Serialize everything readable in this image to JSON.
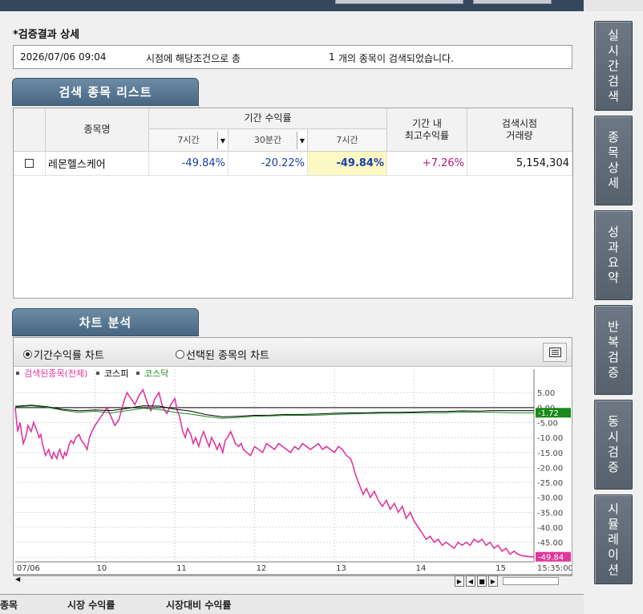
{
  "side_tabs": [
    "실시간검색",
    "종목상세",
    "성과요약",
    "반복검증",
    "동시검증",
    "시뮬레이션"
  ],
  "section_title": "*검증결과 상세",
  "info": {
    "datetime": "2026/07/06 09:04",
    "text1": "시점에 해당조건으로 총",
    "count": "1",
    "text2": "개의 종목이 검색되었습니다."
  },
  "list_tab": "검색 종목 리스트",
  "grid": {
    "header_name": "종목명",
    "header_period": "기간 수익률",
    "sub_7h_a": "7시간",
    "sub_30m": "30분간",
    "sub_7h_b": "7시간",
    "header_max": "기간 내\n최고수익률",
    "header_volume": "검색시점\n거래량",
    "rows": [
      {
        "name": "레몬헬스케어",
        "r1": "-49.84%",
        "r2": "-20.22%",
        "r3": "-49.84%",
        "max": "+7.26%",
        "volume": "5,154,304"
      }
    ]
  },
  "chart_tab": "차트 분석",
  "chart_options": {
    "opt1": "기간수익률 차트",
    "opt2": "선택된 종목의 차트"
  },
  "legend": {
    "s1": "검색된종목(전체)",
    "s2": "코스피",
    "s3": "코스닥"
  },
  "colors": {
    "s1": "#e0379c",
    "s2": "#000000",
    "s3": "#1a8a1a"
  },
  "chart_data": {
    "type": "line",
    "x_labels": [
      "07/06",
      "10",
      "11",
      "12",
      "13",
      "14",
      "15",
      "15:35:00"
    ],
    "y_ticks": [
      5,
      0,
      -5,
      -10,
      -15,
      -20,
      -25,
      -30,
      -35,
      -40,
      -45,
      -50
    ],
    "y_tick_labels": [
      "5.00",
      "0.00",
      "-5.00",
      "-10.00",
      "-15.00",
      "-20.00",
      "-25.00",
      "-30.00",
      "-35.00",
      "-40.00",
      "-45.00",
      "-50.00"
    ],
    "ylim": [
      -51,
      8
    ],
    "legend": "top-left",
    "grid": true,
    "series": [
      {
        "name": "검색된종목(전체)",
        "color": "#e0379c",
        "x": [
          0,
          0.3,
          0.6,
          1,
          1.3,
          1.6,
          2,
          2.3,
          2.6,
          3,
          3.2,
          3.4,
          3.6,
          3.8,
          4,
          4.2,
          4.4,
          4.6,
          4.8,
          5,
          5.2,
          5.4,
          5.6,
          5.8,
          6,
          6.2,
          6.4,
          6.6,
          6.8,
          7,
          7.3,
          7.6,
          8,
          8.3,
          8.6,
          9,
          9.3,
          9.6,
          10,
          10.5,
          11,
          11.5,
          12,
          12.5,
          13,
          13.3,
          13.6,
          14,
          14.5,
          15,
          15.5,
          16,
          16.5,
          17,
          17.5,
          18,
          18.5,
          19,
          19.5,
          20,
          20.3,
          20.6,
          21,
          21.3,
          21.6,
          22,
          22.3,
          22.6,
          23,
          23.3,
          23.6,
          24,
          24.3,
          24.6,
          25,
          25.3,
          25.6,
          26,
          26.3,
          26.6,
          27,
          27.3,
          27.6,
          28,
          28.3,
          28.6,
          29,
          29.5,
          30,
          30.5,
          31,
          31.5,
          32,
          32.5,
          33,
          33.5,
          34,
          34.5,
          35,
          35.5,
          36,
          36.5,
          37,
          37.5,
          38,
          38.5,
          39,
          39.5,
          40,
          40.5,
          41,
          41.5,
          42,
          42.3,
          42.6,
          43,
          43.3,
          43.6,
          44,
          44.5,
          45,
          45.5,
          46,
          46.5,
          47,
          47.5,
          48,
          48.5,
          49,
          49.5,
          50,
          50.5,
          51,
          51.5,
          52,
          52.5,
          53,
          53.5,
          54,
          54.5,
          55,
          55.5,
          56,
          56.5,
          57,
          57.5,
          58,
          58.5,
          59,
          59.5,
          60,
          60.5,
          61,
          61.5,
          62,
          62.5,
          63,
          63.5,
          64,
          64.5,
          65
        ],
        "y": [
          0,
          -8,
          -5,
          -12,
          -10,
          -6,
          -8,
          -5,
          -7,
          -10,
          -9,
          -12,
          -14,
          -16,
          -15,
          -14,
          -16,
          -17,
          -15,
          -16,
          -17,
          -15,
          -14,
          -16,
          -17,
          -15,
          -16,
          -14,
          -12,
          -11,
          -12,
          -10,
          -9,
          -11,
          -12,
          -14,
          -10,
          -8,
          -6,
          -4,
          -2,
          0,
          -3,
          -6,
          -4,
          -1,
          2,
          5,
          3,
          1,
          4,
          6,
          2,
          -1,
          3,
          5,
          0,
          -2,
          1,
          3,
          -1,
          -3,
          -8,
          -10,
          -7,
          -9,
          -12,
          -10,
          -13,
          -10,
          -8,
          -11,
          -13,
          -10,
          -12,
          -14,
          -12,
          -15,
          -11,
          -10,
          -8,
          -10,
          -12,
          -13,
          -12,
          -14,
          -15,
          -16,
          -13,
          -14,
          -15,
          -12,
          -13,
          -14,
          -12,
          -13,
          -14,
          -15,
          -13,
          -14,
          -12,
          -13,
          -14,
          -13,
          -12,
          -14,
          -13,
          -14,
          -15,
          -13,
          -14,
          -16,
          -17,
          -19,
          -22,
          -25,
          -27,
          -29,
          -27,
          -30,
          -28,
          -31,
          -33,
          -31,
          -34,
          -32,
          -35,
          -33,
          -37,
          -35,
          -38,
          -40,
          -42,
          -44,
          -43,
          -45,
          -44,
          -46,
          -45,
          -46,
          -47,
          -45,
          -46,
          -45,
          -46,
          -44,
          -45,
          -44,
          -46,
          -45,
          -47,
          -46,
          -48,
          -47,
          -49,
          -48,
          -49,
          -49.5,
          -49.6,
          -49.84,
          -49.84
        ]
      },
      {
        "name": "코스피",
        "color": "#000000",
        "x": [
          0,
          2,
          4,
          6,
          8,
          10,
          12,
          14,
          16,
          18,
          20,
          22,
          24,
          26,
          28,
          30,
          32,
          34,
          36,
          38,
          40,
          42,
          44,
          46,
          48,
          50,
          52,
          54,
          56,
          58,
          60,
          62,
          65
        ],
        "y": [
          0.4,
          0.8,
          0.3,
          -0.6,
          -1.1,
          -0.8,
          -1.0,
          -0.3,
          0.6,
          0.5,
          -0.5,
          -1.2,
          -2.4,
          -3.1,
          -2.9,
          -2.6,
          -2.5,
          -2.3,
          -2.3,
          -2.1,
          -1.9,
          -1.8,
          -1.7,
          -1.6,
          -1.6,
          -1.5,
          -1.3,
          -1.3,
          -1.1,
          -1.2,
          -1.0,
          -1.0,
          -1.0
        ]
      },
      {
        "name": "코스닥",
        "color": "#1a8a1a",
        "x": [
          0,
          2,
          4,
          6,
          8,
          10,
          12,
          14,
          16,
          18,
          20,
          22,
          24,
          26,
          28,
          30,
          32,
          34,
          36,
          38,
          40,
          42,
          44,
          46,
          48,
          50,
          52,
          54,
          56,
          58,
          60,
          62,
          65
        ],
        "y": [
          0.2,
          0.6,
          0.1,
          -0.9,
          -1.6,
          -1.2,
          -1.8,
          -1.0,
          -0.2,
          -0.6,
          -1.6,
          -2.2,
          -3.0,
          -3.6,
          -3.3,
          -2.9,
          -2.8,
          -2.6,
          -2.6,
          -2.5,
          -2.3,
          -2.1,
          -2.0,
          -1.9,
          -1.9,
          -1.8,
          -1.7,
          -1.7,
          -1.5,
          -1.6,
          -1.6,
          -1.7,
          -1.72
        ]
      }
    ],
    "end_labels": {
      "s1": "-49.84",
      "s3": "-1.72"
    }
  },
  "bottom": {
    "c1": "종목",
    "c2": "시장 수익률",
    "c3": "시장대비 수익률"
  }
}
